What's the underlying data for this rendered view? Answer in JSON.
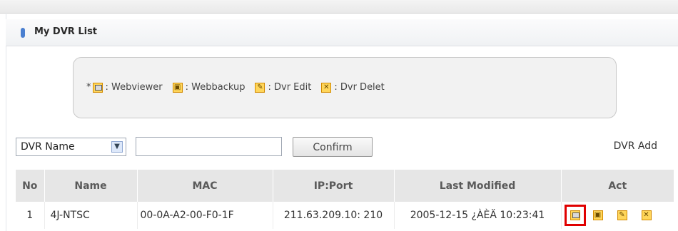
{
  "panel": {
    "title": "My DVR List"
  },
  "legend": {
    "prefix": "*",
    "items": [
      {
        "icon": "webviewer-icon",
        "label": ": Webviewer"
      },
      {
        "icon": "webbackup-icon",
        "label": ": Webbackup"
      },
      {
        "icon": "dvr-edit-icon",
        "label": ": Dvr Edit"
      },
      {
        "icon": "dvr-delete-icon",
        "label": ": Dvr Delet"
      }
    ]
  },
  "search": {
    "field_select": "DVR Name",
    "query_value": "",
    "confirm_label": "Confirm",
    "add_label": "DVR Add"
  },
  "table": {
    "columns": [
      "No",
      "Name",
      "MAC",
      "IP:Port",
      "Last Modified",
      "Act"
    ],
    "rows": [
      {
        "no": "1",
        "name": "4J-NTSC",
        "mac": "00-0A-A2-00-F0-1F",
        "ip_port": "211.63.209.10: 210",
        "last_modified": "2005-12-15 ¿ÀÈÄ 10:23:41"
      }
    ]
  },
  "colors": {
    "accent": "#4a7fd0",
    "highlight": "#e00000",
    "icon_fill": "#ffd65a"
  }
}
